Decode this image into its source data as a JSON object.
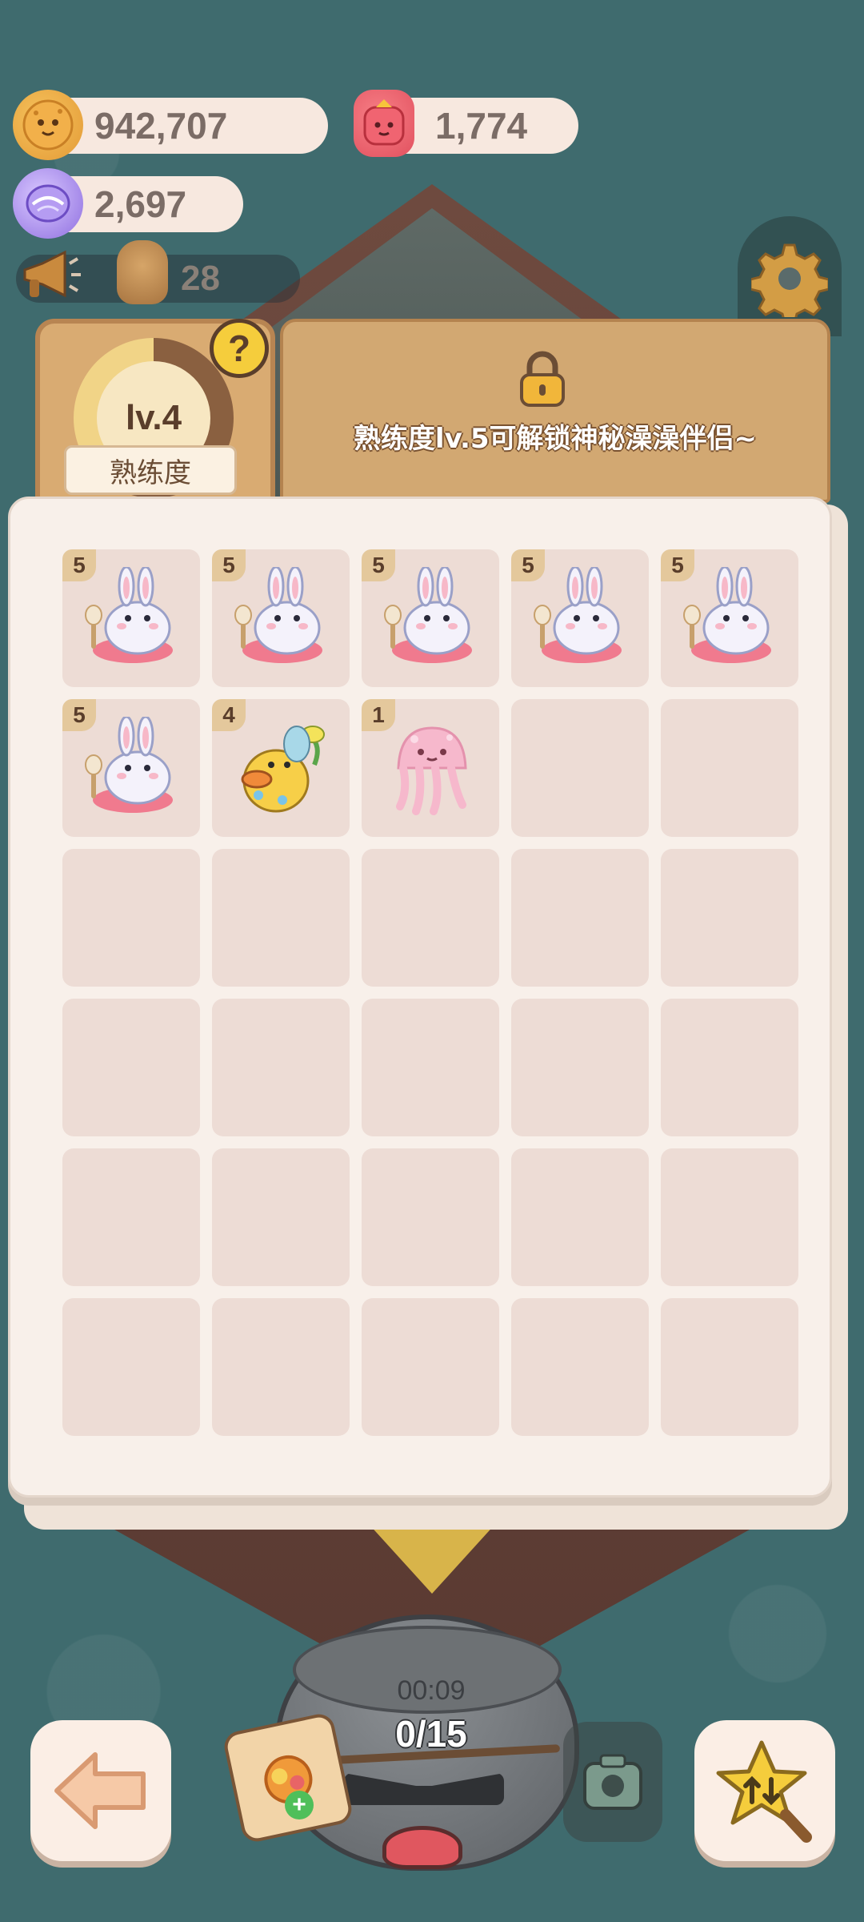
{
  "currencies": {
    "cookies": {
      "value": "942,707",
      "icon": "cookie-icon"
    },
    "candy": {
      "value": "1,774",
      "icon": "candy-icon"
    },
    "gems": {
      "value": "2,697",
      "icon": "gem-icon"
    }
  },
  "notice": {
    "icon": "megaphone-icon",
    "player_icon": "player-icon",
    "count": "28"
  },
  "settings": {
    "icon": "gear-icon"
  },
  "level": {
    "label": "lv.4",
    "proficiency_label": "熟练度",
    "help_symbol": "?",
    "progress_fraction": 0.55
  },
  "unlock": {
    "icon": "lock-icon",
    "text": "熟练度lv.5可解锁神秘澡澡伴侣~"
  },
  "grid": {
    "rows": 6,
    "cols": 5,
    "items": [
      {
        "level": "5",
        "creature": "bunny"
      },
      {
        "level": "5",
        "creature": "bunny"
      },
      {
        "level": "5",
        "creature": "bunny"
      },
      {
        "level": "5",
        "creature": "bunny"
      },
      {
        "level": "5",
        "creature": "bunny"
      },
      {
        "level": "5",
        "creature": "bunny"
      },
      {
        "level": "4",
        "creature": "duck"
      },
      {
        "level": "1",
        "creature": "jellyfish"
      }
    ]
  },
  "pot": {
    "timer": "00:09",
    "count": "0/15"
  },
  "controls": {
    "back_icon": "arrow-left-icon",
    "sort_icon": "star-sort-icon",
    "boost_icon": "boost-bag-icon",
    "camera_icon": "camera-icon"
  },
  "colors": {
    "background": "#3f6b6e",
    "board": "#f8f0ea",
    "cell": "#eddcd5",
    "badge": "#e4c89c",
    "accent": "#f5cd3c"
  }
}
